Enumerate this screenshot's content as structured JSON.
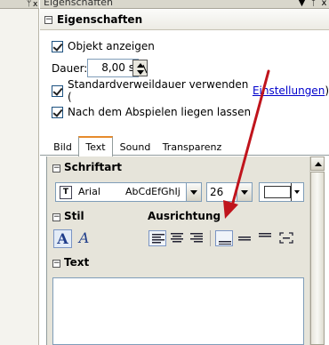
{
  "window": {
    "title": "Eigenschaften",
    "buttons": {
      "dropdown": "▼",
      "pin": "ᛘ",
      "close": "x"
    }
  },
  "section": {
    "title": "Eigenschaften",
    "collapse_glyph": "−"
  },
  "options": {
    "show_object": {
      "label": "Objekt anzeigen",
      "checked": true
    },
    "duration": {
      "label": "Dauer:",
      "value": "8,00 s"
    },
    "default_duration": {
      "label": "Standardverweildauer verwenden (",
      "link": "Einstellungen",
      "suffix": ")",
      "checked": true
    },
    "keep_after_play": {
      "label": "Nach dem Abspielen liegen lassen",
      "checked": true
    }
  },
  "tabs": [
    {
      "label": "Bild",
      "active": false
    },
    {
      "label": "Text",
      "active": true
    },
    {
      "label": "Sound",
      "active": false
    },
    {
      "label": "Transparenz",
      "active": false
    }
  ],
  "text_panel": {
    "font_section": "Schriftart",
    "font_name": "Arial",
    "font_sample": "AbCdEfGhIj",
    "font_icon": "T",
    "font_size": "26",
    "style_section": "Stil",
    "style_buttons": {
      "bold": "A",
      "italic": "A"
    },
    "alignment_section": "Ausrichtung",
    "text_section": "Text",
    "text_value": ""
  },
  "annotation": {
    "arrow_color": "#c0141c"
  },
  "colors": {
    "text_color_swatch": "#ffffff",
    "tab_accent": "#e68b2c",
    "link": "#0000cc"
  }
}
